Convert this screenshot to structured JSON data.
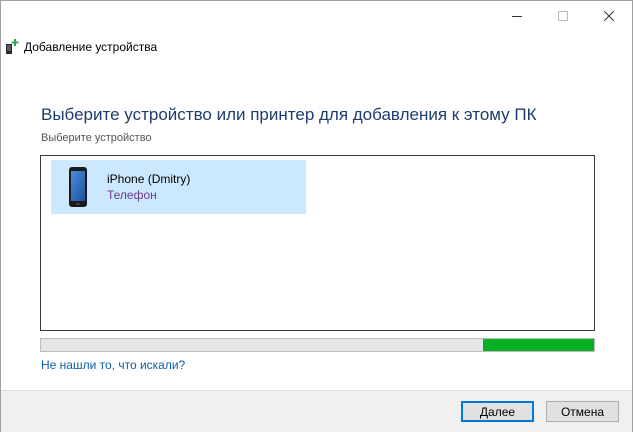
{
  "window": {
    "title": "Добавление устройства"
  },
  "titlebar": {
    "controls": [
      "minimize-icon",
      "maximize-icon",
      "close-icon"
    ]
  },
  "main": {
    "heading": "Выберите устройство или принтер для добавления к этому ПК",
    "subheading": "Выберите устройство",
    "devices": [
      {
        "name": "iPhone (Dmitry)",
        "type": "Телефон",
        "icon": "phone-icon",
        "selected": true
      }
    ],
    "progress": {
      "indeterminate": true,
      "chunk_start": 0.8,
      "chunk_end": 1.0,
      "color": "#06b025"
    },
    "help_link": "Не нашли то, что искали?"
  },
  "footer": {
    "next_label": "Далее",
    "cancel_label": "Отмена"
  },
  "colors": {
    "heading": "#1c3d6e",
    "selection": "#cce8ff",
    "device_type": "#6a3a8e",
    "link": "#0b5ea8",
    "primary_border": "#0078d7"
  }
}
